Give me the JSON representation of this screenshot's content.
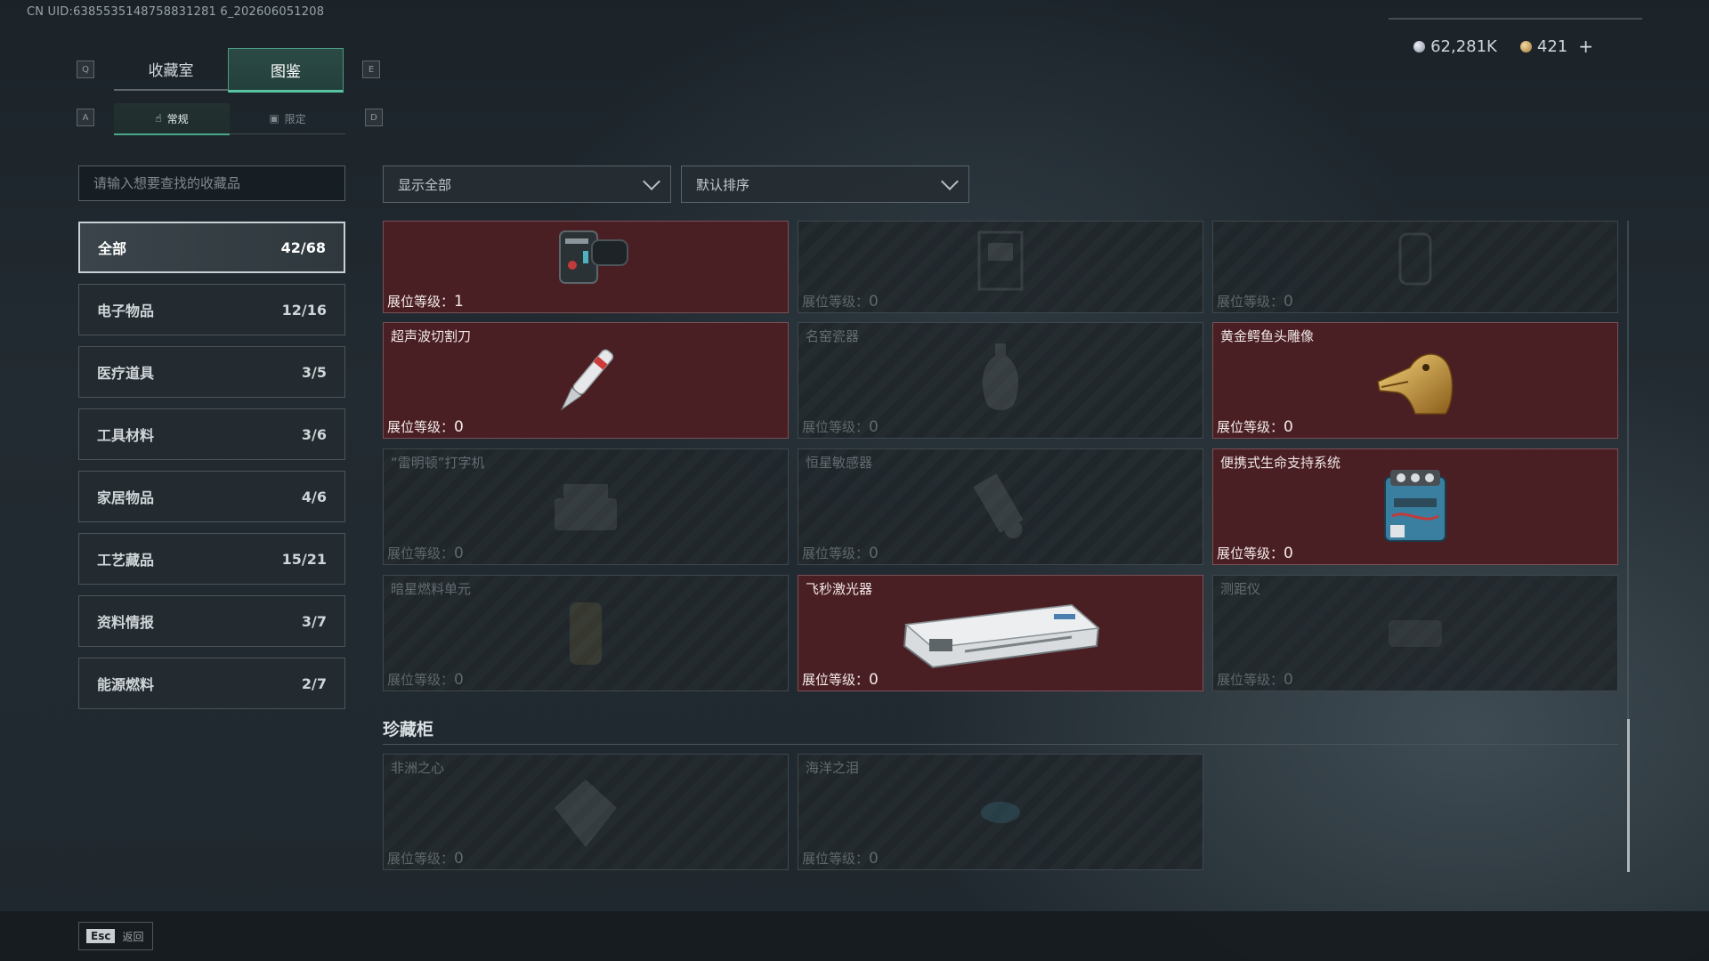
{
  "uid_text": "CN UID:6385535148758831281 6_202606051208",
  "currency": {
    "silver": "62,281K",
    "gold": "421",
    "plus": "+"
  },
  "keys": {
    "q": "Q",
    "e": "E",
    "a": "A",
    "d": "D"
  },
  "tabs": [
    {
      "label": "收藏室"
    },
    {
      "label": "图鉴",
      "active": true
    }
  ],
  "subtabs": [
    {
      "label": "常规",
      "icon": "hand-icon",
      "active": true
    },
    {
      "label": "限定",
      "icon": "image-icon"
    }
  ],
  "search": {
    "placeholder": "请输入想要查找的收藏品"
  },
  "categories": [
    {
      "label": "全部",
      "count": "42/68",
      "active": true
    },
    {
      "label": "电子物品",
      "count": "12/16"
    },
    {
      "label": "医疗道具",
      "count": "3/5"
    },
    {
      "label": "工具材料",
      "count": "3/6"
    },
    {
      "label": "家居物品",
      "count": "4/6"
    },
    {
      "label": "工艺藏品",
      "count": "15/21"
    },
    {
      "label": "资料情报",
      "count": "3/7"
    },
    {
      "label": "能源燃料",
      "count": "2/7"
    }
  ],
  "filters": {
    "show": "显示全部",
    "sort": "默认排序"
  },
  "level_label": "展位等级：",
  "items": [
    {
      "name": "",
      "level": "1",
      "owned": true,
      "icon": "collar-device-icon"
    },
    {
      "name": "",
      "level": "0",
      "owned": false,
      "icon": "press-machine-icon"
    },
    {
      "name": "",
      "level": "0",
      "owned": false,
      "icon": "lantern-icon"
    },
    {
      "name": "超声波切割刀",
      "level": "0",
      "owned": true,
      "icon": "ultrasonic-knife-icon"
    },
    {
      "name": "名窑瓷器",
      "level": "0",
      "owned": false,
      "icon": "porcelain-vase-icon"
    },
    {
      "name": "黄金鳄鱼头雕像",
      "level": "0",
      "owned": true,
      "icon": "gold-crocodile-head-icon"
    },
    {
      "name": "“雷明顿”打字机",
      "level": "0",
      "owned": false,
      "icon": "typewriter-icon"
    },
    {
      "name": "恒星敏感器",
      "level": "0",
      "owned": false,
      "icon": "star-sensor-icon"
    },
    {
      "name": "便携式生命支持系统",
      "level": "0",
      "owned": true,
      "icon": "life-support-icon"
    },
    {
      "name": "暗星燃料单元",
      "level": "0",
      "owned": false,
      "icon": "fuel-cell-icon"
    },
    {
      "name": "飞秒激光器",
      "level": "0",
      "owned": true,
      "icon": "femto-laser-icon"
    },
    {
      "name": "测距仪",
      "level": "0",
      "owned": false,
      "icon": "rangefinder-icon"
    }
  ],
  "vault": {
    "title": "珍藏柜",
    "items": [
      {
        "name": "非洲之心",
        "level": "0",
        "owned": false,
        "icon": "diamond-icon"
      },
      {
        "name": "海洋之泪",
        "level": "0",
        "owned": false,
        "icon": "gem-icon"
      }
    ]
  },
  "footer": {
    "esc_key": "Esc",
    "back_label": "返回"
  }
}
